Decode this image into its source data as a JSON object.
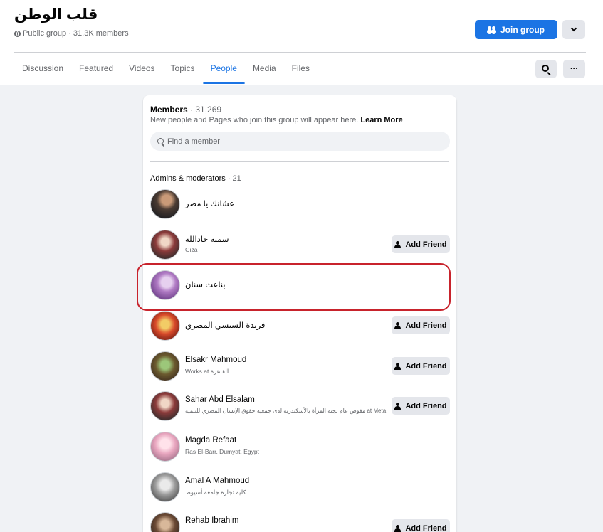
{
  "group": {
    "name": "قلب الوطن",
    "meta": "Public group · 31.3K members",
    "join_label": "Join group"
  },
  "tabs": [
    {
      "label": "Discussion",
      "active": false
    },
    {
      "label": "Featured",
      "active": false
    },
    {
      "label": "Videos",
      "active": false
    },
    {
      "label": "Topics",
      "active": false
    },
    {
      "label": "People",
      "active": true
    },
    {
      "label": "Media",
      "active": false
    },
    {
      "label": "Files",
      "active": false
    }
  ],
  "header_actions": {
    "more_label": "···"
  },
  "members": {
    "label": "Members",
    "count": " · 31,269",
    "note": "New people and Pages who join this group will appear here.",
    "learn_more": "Learn More",
    "search_placeholder": "Find a member"
  },
  "admins": {
    "title": "Admins & moderators",
    "count": " · 21",
    "add_friend_label": "Add Friend",
    "list": [
      {
        "name": "عشانك يا مصر",
        "sub": "",
        "add_friend": false
      },
      {
        "name": "سمية جادالله",
        "sub": "Giza",
        "add_friend": true
      },
      {
        "name": "بناعث سنان",
        "sub": "",
        "add_friend": false,
        "highlighted": true
      },
      {
        "name": "فريدة السيسي المصري",
        "sub": "",
        "add_friend": true
      },
      {
        "name": "Elsakr Mahmoud",
        "sub": "Works at القاهرة",
        "add_friend": true
      },
      {
        "name": "Sahar Abd Elsalam",
        "sub": "مفوض عام لجنة المرأة بالأسكندرية لدى جمعية حقوق الإنسان المصري للتنمية at Meta",
        "add_friend": true
      },
      {
        "name": "Magda Refaat",
        "sub": "Ras El-Barr, Dumyat, Egypt",
        "add_friend": false
      },
      {
        "name": "Amal A Mahmoud",
        "sub": "كلية تجارة جامعة أسيوط",
        "add_friend": false
      },
      {
        "name": "Rehab Ibrahim",
        "sub": "",
        "add_friend": true
      }
    ]
  },
  "colors": {
    "accent": "#1b74e4",
    "highlight_ring": "#c8232c",
    "background": "#f0f2f5"
  },
  "icons": [
    "globe-icon",
    "join-group-icon",
    "chevron-down-icon",
    "search-icon",
    "more-icon",
    "add-friend-icon"
  ]
}
